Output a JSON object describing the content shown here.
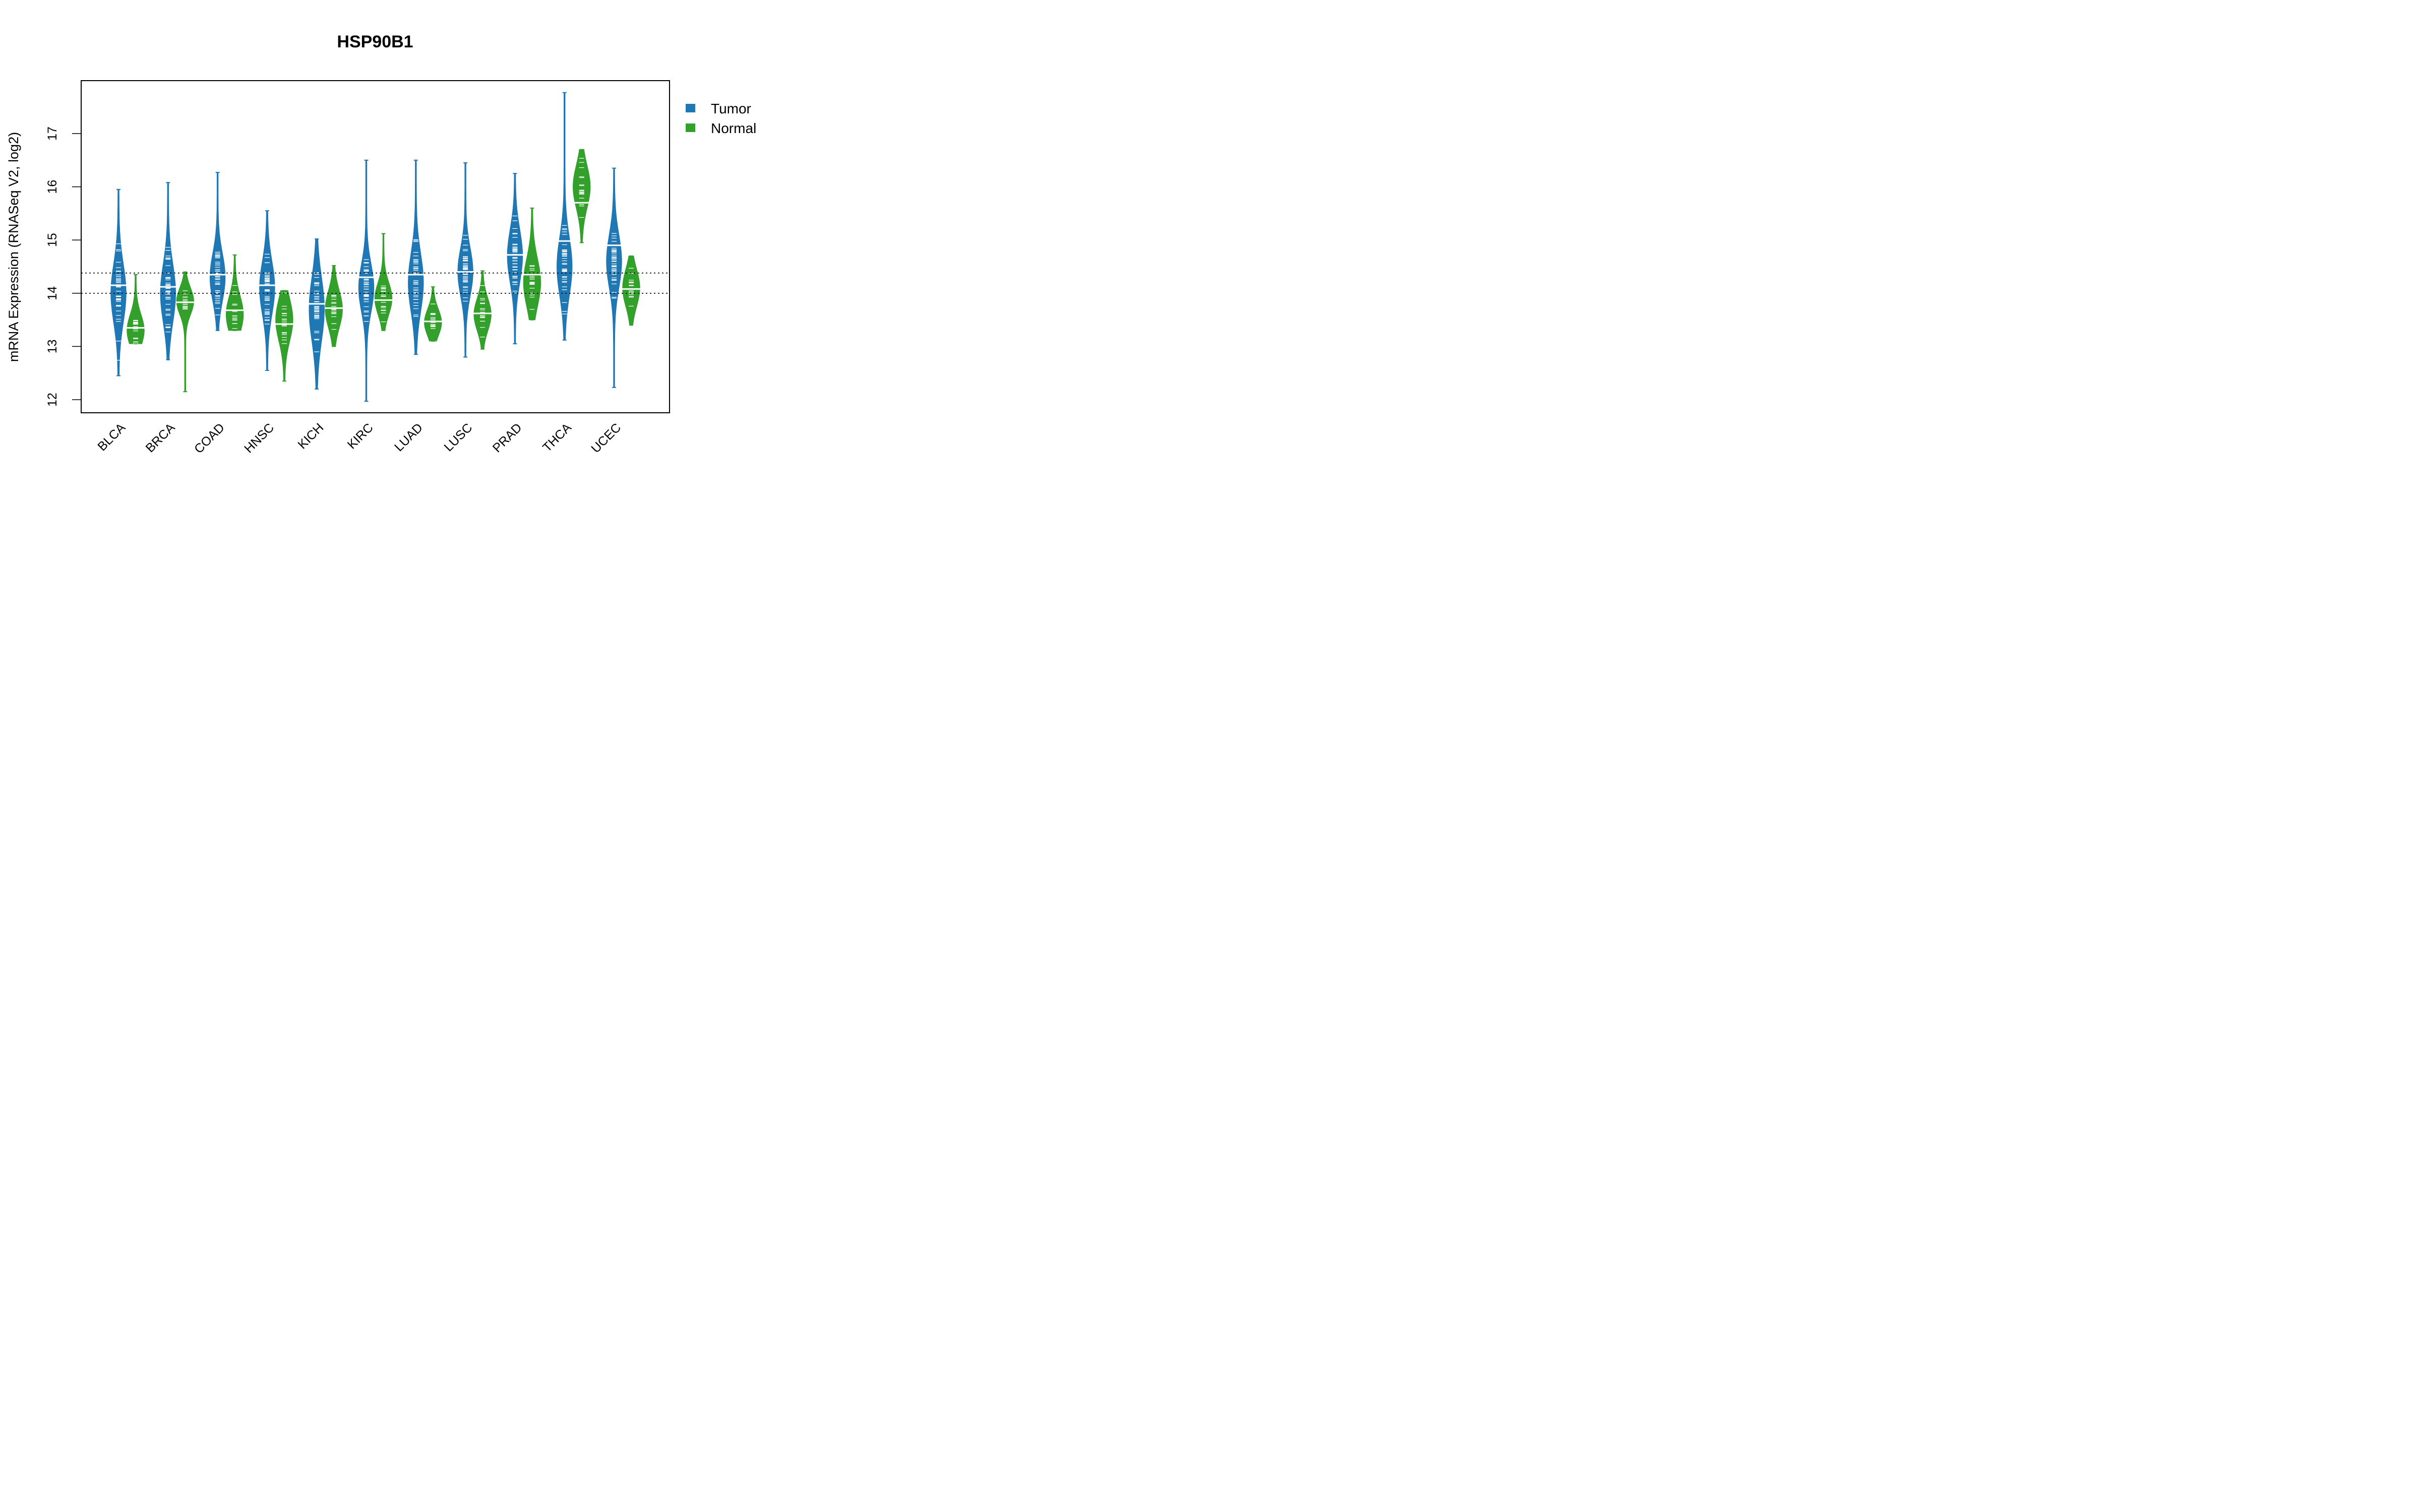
{
  "chart_data": {
    "type": "beanplot",
    "title": "HSP90B1",
    "xlabel": "",
    "ylabel": "mRNA Expression (RNASeq V2, log2)",
    "ylim": [
      11.8,
      18.0
    ],
    "yticks": [
      12,
      13,
      14,
      15,
      16,
      17
    ],
    "categories": [
      "BLCA",
      "BRCA",
      "COAD",
      "HNSC",
      "KICH",
      "KIRC",
      "LUAD",
      "LUSC",
      "PRAD",
      "THCA",
      "UCEC"
    ],
    "reference_lines": [
      14.0,
      14.38
    ],
    "grid": false,
    "legend_position": "right-top-outside",
    "series": [
      {
        "name": "Tumor",
        "color": "#1F78B4",
        "median": [
          14.15,
          14.12,
          14.35,
          14.15,
          13.8,
          14.3,
          14.35,
          14.4,
          14.72,
          14.98,
          14.9
        ],
        "min": [
          12.45,
          12.75,
          13.3,
          12.55,
          12.2,
          11.97,
          12.85,
          12.8,
          13.05,
          13.12,
          12.23
        ],
        "max": [
          15.95,
          16.08,
          16.27,
          15.55,
          15.02,
          16.5,
          16.5,
          16.45,
          16.25,
          17.77,
          16.35
        ],
        "density_peak": [
          14.0,
          14.0,
          14.3,
          14.1,
          13.7,
          14.1,
          14.2,
          14.4,
          14.7,
          14.5,
          14.6
        ],
        "spread": [
          0.55,
          0.55,
          0.45,
          0.5,
          0.6,
          0.45,
          0.55,
          0.45,
          0.5,
          0.55,
          0.5
        ]
      },
      {
        "name": "Normal",
        "color": "#33A02C",
        "median": [
          13.35,
          13.83,
          13.68,
          13.42,
          13.72,
          13.87,
          13.47,
          13.62,
          14.35,
          15.7,
          14.08
        ],
        "min": [
          13.05,
          12.15,
          13.3,
          12.35,
          13.0,
          13.3,
          13.1,
          12.95,
          13.5,
          14.95,
          13.4
        ],
        "max": [
          14.35,
          14.4,
          14.72,
          14.05,
          14.52,
          15.12,
          14.12,
          14.42,
          15.6,
          16.7,
          14.7
        ],
        "density_peak": [
          13.3,
          13.85,
          13.6,
          13.5,
          13.7,
          13.9,
          13.45,
          13.6,
          14.2,
          16.0,
          14.1
        ],
        "spread": [
          0.3,
          0.25,
          0.35,
          0.4,
          0.35,
          0.3,
          0.25,
          0.3,
          0.45,
          0.4,
          0.35
        ]
      }
    ]
  }
}
